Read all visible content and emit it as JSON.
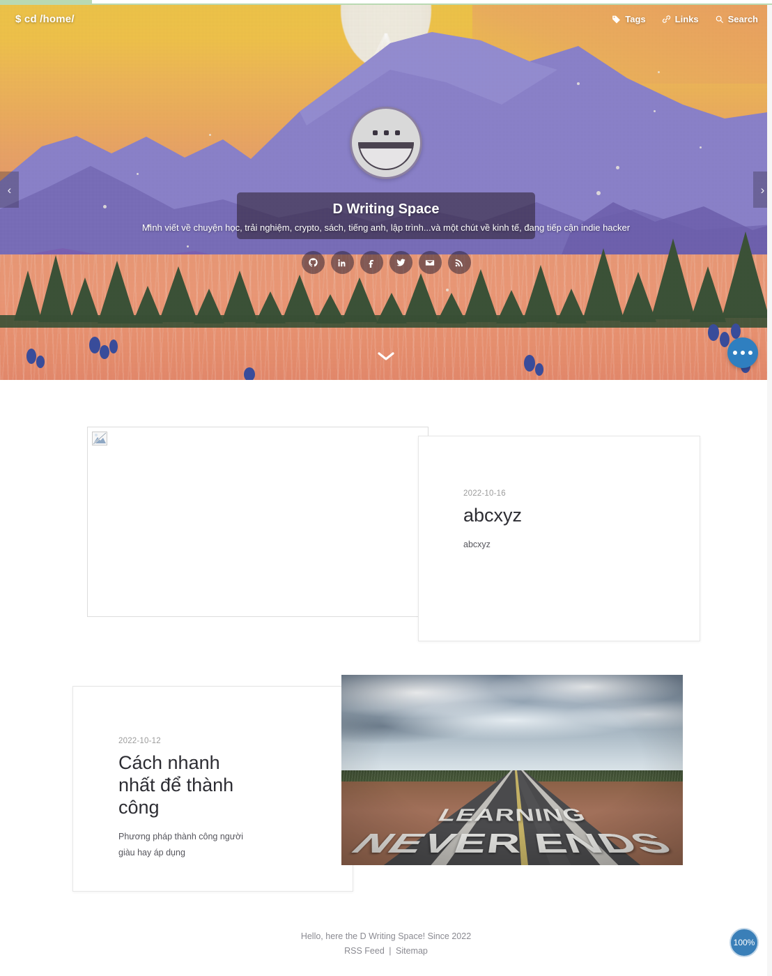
{
  "hero": {
    "command_prompt": "$ cd /home/",
    "nav": [
      {
        "label": "Tags",
        "icon": "tag-icon"
      },
      {
        "label": "Links",
        "icon": "link-icon"
      },
      {
        "label": "Search",
        "icon": "search-icon"
      }
    ],
    "avatar_alt": "smiley-face-avatar",
    "title": "D Writing Space",
    "description": "Mình viết về chuyện học, trải nghiệm, crypto, sách, tiếng anh, lập trình...và một chút về kinh tế, đang tiếp cận indie hacker",
    "socials": [
      {
        "name": "github-icon",
        "label": "GitHub"
      },
      {
        "name": "linkedin-icon",
        "label": "LinkedIn"
      },
      {
        "name": "facebook-icon",
        "label": "Facebook"
      },
      {
        "name": "twitter-icon",
        "label": "Twitter"
      },
      {
        "name": "email-icon",
        "label": "Email"
      },
      {
        "name": "rss-icon",
        "label": "RSS"
      }
    ],
    "carousel": {
      "prev_label": "‹",
      "next_label": "›"
    },
    "scroll_down_label": "Scroll down"
  },
  "posts": [
    {
      "date": "2022-10-16",
      "title": "abcxyz",
      "excerpt": "abcxyz",
      "thumbnail": "broken-image"
    },
    {
      "date": "2022-10-12",
      "title": "Cách nhanh nhất để thành công",
      "excerpt": "Phương pháp thành công người giàu hay áp dụng",
      "thumbnail": "learning-never-ends-photo",
      "thumbnail_text_line1": "LEARNING",
      "thumbnail_text_line2": "NEVER ENDS"
    }
  ],
  "fab": {
    "label": "More options",
    "icon": "ellipsis-icon"
  },
  "footer": {
    "tagline": "Hello, here the D Writing Space! Since 2022",
    "rss_label": "RSS Feed",
    "separator": "|",
    "sitemap_label": "Sitemap"
  },
  "progress": {
    "value": "100%"
  },
  "colors": {
    "accent_blue": "#2f7fc0",
    "progress_blue": "#3a7fb8",
    "hero_card_overlay": "#34263c",
    "text_dark": "#2d2d33",
    "text_muted": "#8a8a91"
  }
}
